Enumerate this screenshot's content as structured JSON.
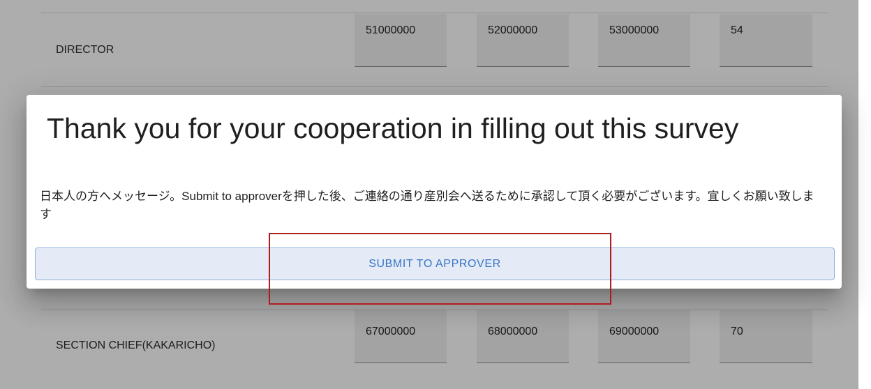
{
  "table": {
    "rows": [
      {
        "label": "DIRECTOR",
        "cells": [
          "51000000",
          "52000000",
          "53000000",
          "54"
        ]
      },
      {
        "label": "SECTION CHIEF(KAKARICHO)",
        "cells": [
          "67000000",
          "68000000",
          "69000000",
          "70"
        ]
      }
    ]
  },
  "dialog": {
    "title": "Thank you for your cooperation in filling out this survey",
    "message": "日本人の方へメッセージ。Submit to approverを押した後、ご連絡の通り産別会へ送るために承認して頂く必要がございます。宜しくお願い致します",
    "submit_label": "SUBMIT TO APPROVER"
  },
  "colors": {
    "highlight": "#b01c1c",
    "button_text": "#3574c4",
    "button_bg": "#e4ebf6"
  }
}
